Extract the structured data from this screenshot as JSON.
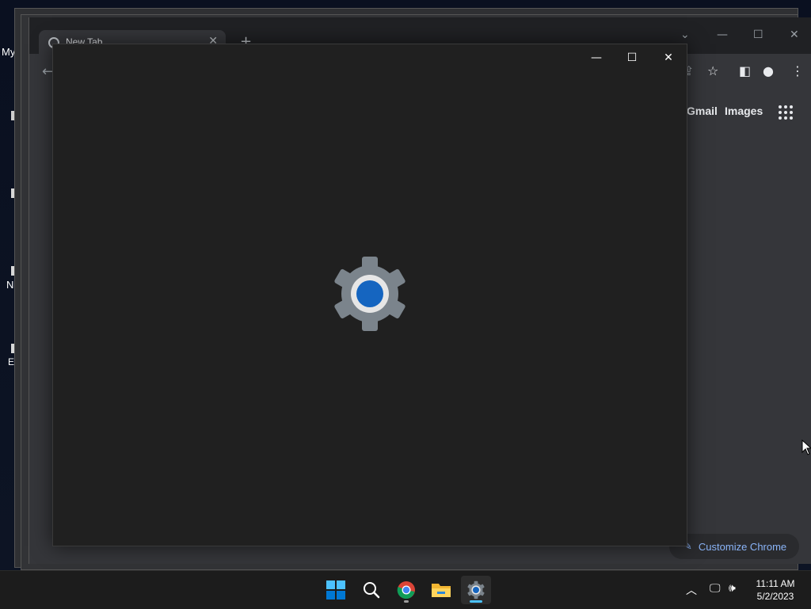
{
  "desktop": {
    "labels": [
      "My",
      "N",
      "E"
    ]
  },
  "chrome": {
    "tab": {
      "title": "New Tab",
      "close_glyph": "✕"
    },
    "new_tab_glyph": "+",
    "ntp": {
      "gmail": "Gmail",
      "images": "Images",
      "customize": "Customize Chrome"
    },
    "colors": {
      "accent": "#8ab4f8",
      "frame": "#202124",
      "surface": "#35363a"
    }
  },
  "settings_window": {
    "icon": "settings-gear-icon",
    "colors": {
      "background": "#202020",
      "gear_outer": "#7b848c",
      "gear_inner_ring": "#e6e6e6",
      "gear_center": "#1565c0"
    }
  },
  "taskbar": {
    "apps": [
      {
        "name": "start",
        "icon": "windows-start-icon"
      },
      {
        "name": "search",
        "icon": "search-icon"
      },
      {
        "name": "chrome",
        "icon": "chrome-icon"
      },
      {
        "name": "file-explorer",
        "icon": "folder-icon"
      },
      {
        "name": "settings",
        "icon": "settings-gear-icon"
      }
    ],
    "clock": {
      "time": "11:11 AM",
      "date": "5/2/2023"
    }
  }
}
